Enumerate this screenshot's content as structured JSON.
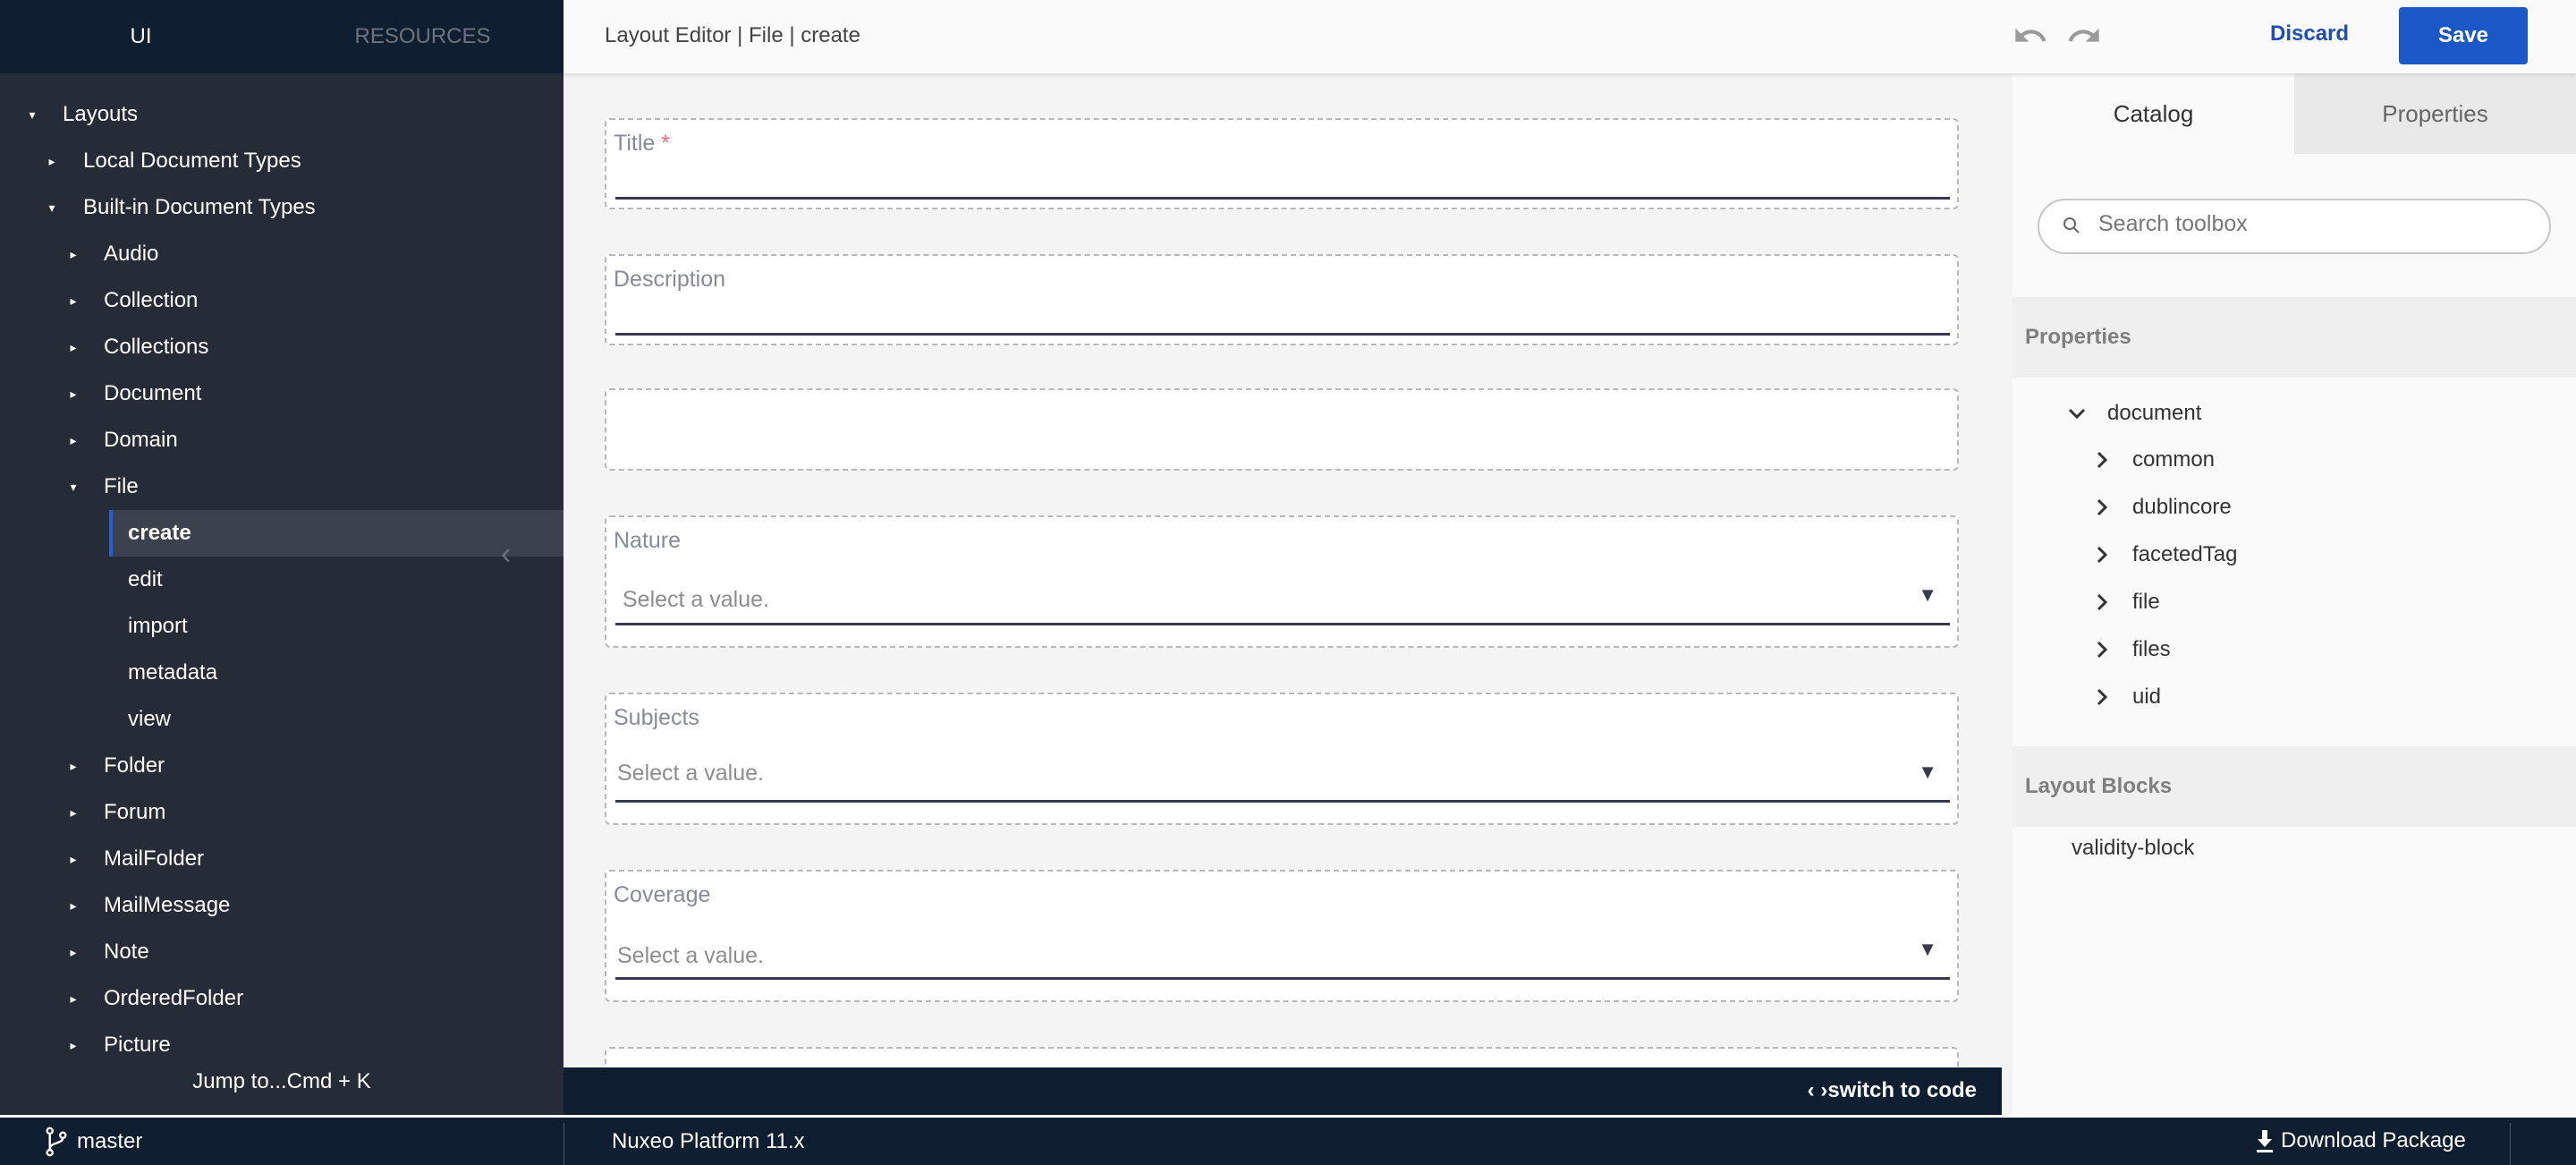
{
  "sidebar": {
    "tabs": [
      {
        "label": "UI",
        "active": true
      },
      {
        "label": "RESOURCES",
        "active": false
      }
    ],
    "tree": [
      {
        "label": "Layouts",
        "level": 0,
        "expanded": true
      },
      {
        "label": "Local Document Types",
        "level": 1,
        "expanded": false
      },
      {
        "label": "Built-in Document Types",
        "level": 1,
        "expanded": true
      },
      {
        "label": "Audio",
        "level": 2,
        "expanded": false
      },
      {
        "label": "Collection",
        "level": 2,
        "expanded": false
      },
      {
        "label": "Collections",
        "level": 2,
        "expanded": false
      },
      {
        "label": "Document",
        "level": 2,
        "expanded": false
      },
      {
        "label": "Domain",
        "level": 2,
        "expanded": false
      },
      {
        "label": "File",
        "level": 2,
        "expanded": true
      },
      {
        "label": "create",
        "level": 3,
        "selected": true
      },
      {
        "label": "edit",
        "level": 3
      },
      {
        "label": "import",
        "level": 3
      },
      {
        "label": "metadata",
        "level": 3
      },
      {
        "label": "view",
        "level": 3
      },
      {
        "label": "Folder",
        "level": 2,
        "expanded": false
      },
      {
        "label": "Forum",
        "level": 2,
        "expanded": false
      },
      {
        "label": "MailFolder",
        "level": 2,
        "expanded": false
      },
      {
        "label": "MailMessage",
        "level": 2,
        "expanded": false
      },
      {
        "label": "Note",
        "level": 2,
        "expanded": false
      },
      {
        "label": "OrderedFolder",
        "level": 2,
        "expanded": false
      },
      {
        "label": "Picture",
        "level": 2,
        "expanded": false
      }
    ],
    "jump_to": "Jump to...Cmd + K"
  },
  "header": {
    "breadcrumb": "Layout Editor | File | create",
    "discard_label": "Discard",
    "save_label": "Save"
  },
  "form": {
    "fields": [
      {
        "label": "Title",
        "required_mark": "*",
        "type": "text"
      },
      {
        "label": "Description",
        "type": "text"
      },
      {
        "label": "",
        "type": "empty"
      },
      {
        "label": "Nature",
        "type": "select",
        "placeholder": "Select a value."
      },
      {
        "label": "Subjects",
        "type": "select",
        "placeholder": "Select a value."
      },
      {
        "label": "Coverage",
        "type": "select",
        "placeholder": "Select a value."
      }
    ],
    "switch_to_code": "switch to code"
  },
  "right_panel": {
    "tabs": [
      {
        "label": "Catalog",
        "active": true
      },
      {
        "label": "Properties",
        "active": false
      }
    ],
    "search_placeholder": "Search toolbox",
    "properties_heading": "Properties",
    "properties_tree": {
      "root": "document",
      "children": [
        "common",
        "dublincore",
        "facetedTag",
        "file",
        "files",
        "uid"
      ]
    },
    "layout_blocks_heading": "Layout Blocks",
    "layout_blocks": [
      "validity-block"
    ]
  },
  "footer": {
    "branch": "master",
    "platform": "Nuxeo Platform 11.x",
    "download_label": "Download Package"
  },
  "colors": {
    "primary": "#1b57c7",
    "sidebar_bg": "#252b37",
    "navy": "#0f1e30",
    "required": "#f06b7a"
  }
}
